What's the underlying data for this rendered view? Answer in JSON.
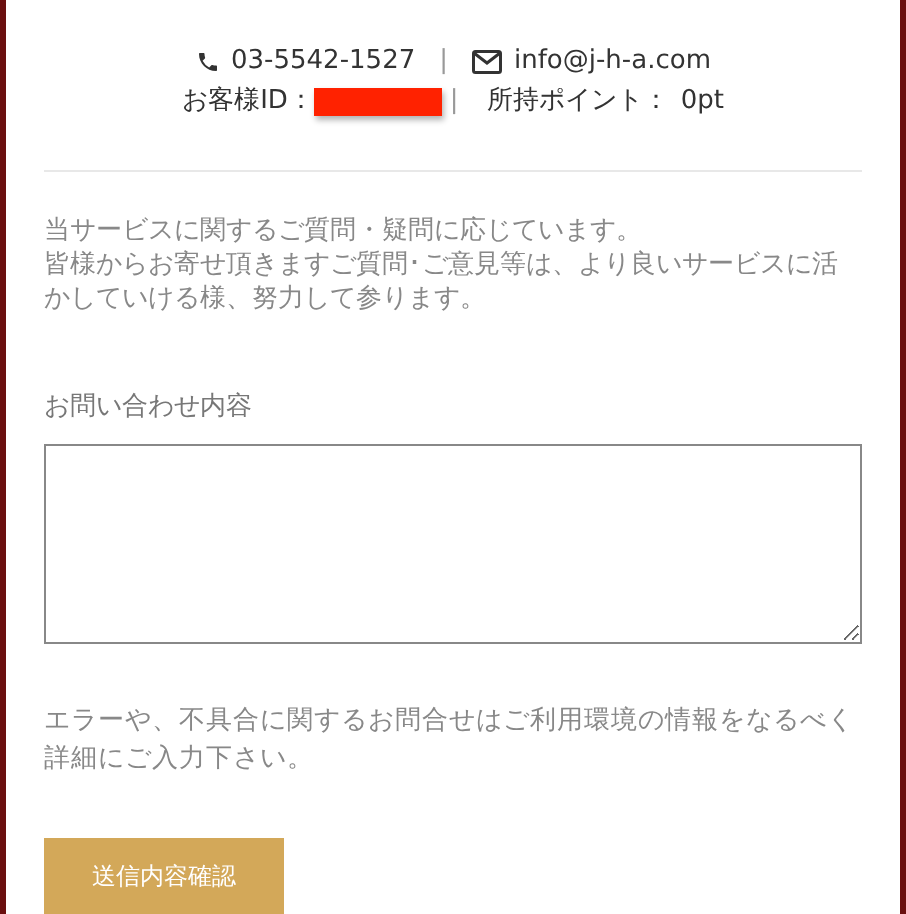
{
  "contact": {
    "phone": "03-5542-1527",
    "separator": "|",
    "email": "info@j-h-a.com"
  },
  "account": {
    "id_label": "お客様ID：",
    "separator": "|",
    "points_label": "所持ポイント：",
    "points": "0pt"
  },
  "intro": [
    "当サービスに関するご質問・疑問に応じています。",
    "皆様からお寄せ頂きますご質問･ご意見等は、より良いサービスに活かしていける様、努力して参ります。"
  ],
  "inquiry": {
    "label": "お問い合わせ内容"
  },
  "note": "エラーや、不具合に関するお問合せはご利用環境の情報をなるべく詳細にご入力下さい。",
  "submit": {
    "label": "送信内容確認"
  }
}
